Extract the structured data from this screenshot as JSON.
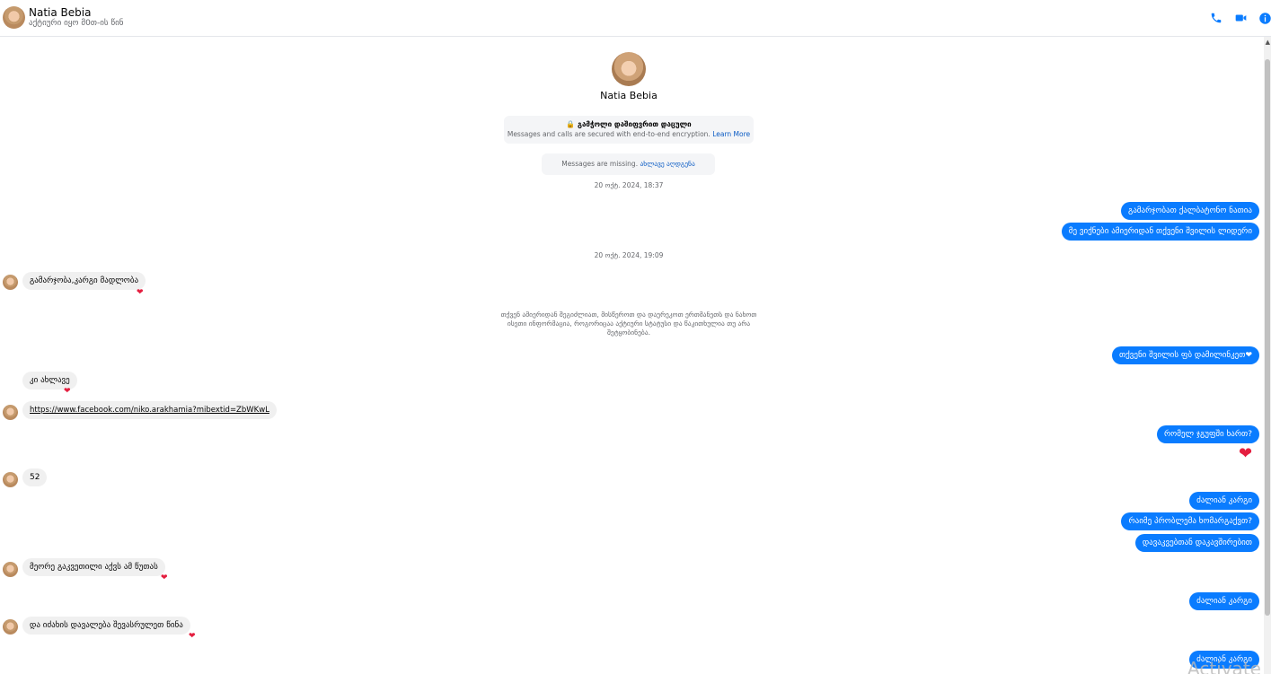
{
  "header": {
    "name": "Natia Bebia",
    "status": "აქტიური იყო მ0თ-ის წინ"
  },
  "profile": {
    "name": "Natia Bebia"
  },
  "encryption": {
    "title": "🔒 გამჭოლი დაშიფვრით დაცული",
    "subtitle": "Messages and calls are secured with end-to-end encryption.",
    "link": "Learn More"
  },
  "missing": {
    "text": "Messages are missing.",
    "link": "ახლავე აღდგენა"
  },
  "timestamps": [
    "20 ოქტ. 2024, 18:37",
    "20 ოქტ. 2024, 19:09"
  ],
  "system_note": "თქვენ ამიერიდან შეგიძლიათ, მისწეროთ და დაურეკოთ ერთმანეთს და ნახოთ ისეთი ინფორმაცია, როგორიცაა აქტიური სტატუსი და წაკითხულია თუ არა შეტყობინება.",
  "messages": [
    {
      "dir": "out",
      "text": "გამარჯობათ ქალბატონო ნათია"
    },
    {
      "dir": "out",
      "text": "მე ვიქნები ამიერიდან თქვენი შვილის ლიდერი"
    },
    {
      "dir": "in",
      "text": "გამარჯობა,კარგი მადლობა",
      "reaction": "❤"
    },
    {
      "dir": "out",
      "text": "თქვენი შვილის ფბ დამილინკეთ❤"
    },
    {
      "dir": "in",
      "text": "კი ახლავე",
      "reaction": "❤"
    },
    {
      "dir": "in",
      "text": "https://www.facebook.com/niko.arakhamia?mibextid=ZbWKwL"
    },
    {
      "dir": "out",
      "text": "რომელ ჯგუფში ხართ?"
    },
    {
      "dir": "out-emoji",
      "text": "❤"
    },
    {
      "dir": "in",
      "text": "52"
    },
    {
      "dir": "out",
      "text": "ძალიან კარგი"
    },
    {
      "dir": "out",
      "text": "რაიმე პრობლემა ხომარგაქვთ?"
    },
    {
      "dir": "out",
      "text": "დავაკვებთან დაკავშირებით"
    },
    {
      "dir": "in",
      "text": "მეორე გაკვეთილი აქვს ამ წუთას",
      "reaction": "❤"
    },
    {
      "dir": "out",
      "text": "ძალიან კარგი"
    },
    {
      "dir": "in",
      "text": "და იძახის დავალება შევასრულეთ წინა",
      "reaction": "❤"
    },
    {
      "dir": "out",
      "text": "ძალიან კარგი"
    }
  ],
  "watermark": "Activate",
  "colors": {
    "accent": "#0a7cff",
    "incoming": "#f0f0f0",
    "heart": "#e41e3f"
  }
}
